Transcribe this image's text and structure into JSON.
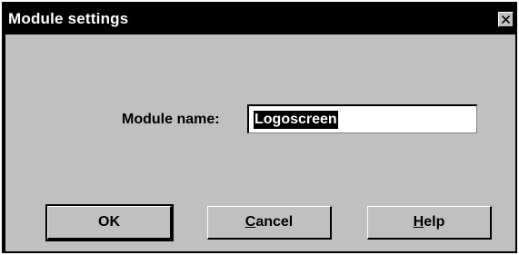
{
  "window": {
    "title": "Module settings",
    "close_icon": "close-icon"
  },
  "form": {
    "module_name_label": "Module name:",
    "module_name_value": "Logoscreen"
  },
  "buttons": {
    "ok": {
      "label": "OK"
    },
    "cancel": {
      "mnemonic": "C",
      "rest": "ancel"
    },
    "help": {
      "mnemonic": "H",
      "rest": "elp"
    }
  },
  "colors": {
    "dialog_face": "#c0c0c0",
    "titlebar": "#000000",
    "title_text": "#ffffff",
    "selection": "#000000"
  }
}
